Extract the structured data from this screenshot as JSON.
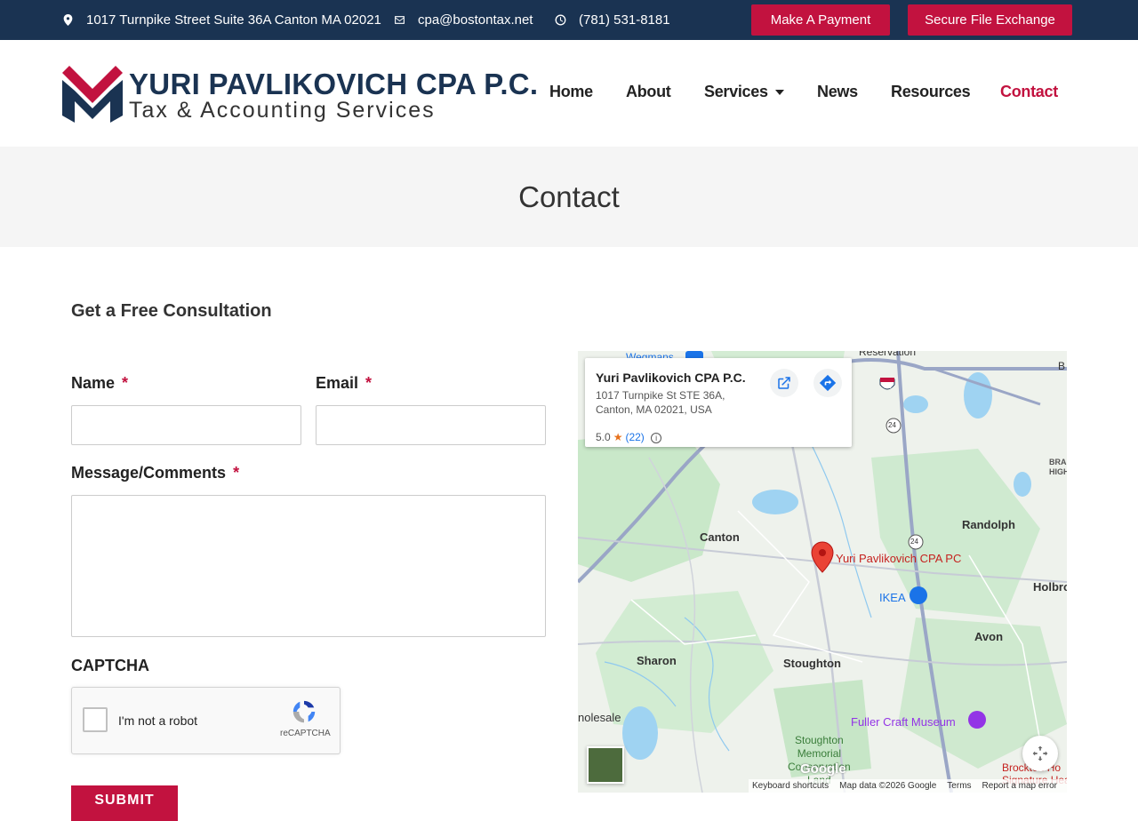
{
  "topbar": {
    "address": "1017 Turnpike Street Suite 36A Canton MA 02021",
    "email": "cpa@bostontax.net",
    "phone": "(781) 531-8181",
    "payment_button": "Make A Payment",
    "file_exchange_button": "Secure File Exchange"
  },
  "logo": {
    "title": "YURI PAVLIKOVICH CPA P.C.",
    "subtitle": "Tax & Accounting Services"
  },
  "nav": {
    "home": "Home",
    "about": "About",
    "services": "Services",
    "news": "News",
    "resources": "Resources",
    "contact": "Contact"
  },
  "page": {
    "title": "Contact"
  },
  "form": {
    "heading": "Get a Free Consultation",
    "name_label": "Name",
    "email_label": "Email",
    "message_label": "Message/Comments",
    "captcha_label": "CAPTCHA",
    "required_mark": "*",
    "captcha_text": "I'm not a robot",
    "captcha_brand": "reCAPTCHA",
    "submit": "SUBMIT"
  },
  "map": {
    "card_title": "Yuri Pavlikovich CPA P.C.",
    "card_address_line1": "1017 Turnpike St STE 36A,",
    "card_address_line2": "Canton, MA 02021, USA",
    "rating": "5.0",
    "review_count": "(22)",
    "places": {
      "wegmans": "Wegmans",
      "reservation": "Reservation",
      "canton": "Canton",
      "randolph": "Randolph",
      "holbrook": "Holbro",
      "ikea": "IKEA",
      "avon": "Avon",
      "sharon": "Sharon",
      "stoughton": "Stoughton",
      "fuller": "Fuller Craft Museum",
      "wholesale": "nolesale",
      "memorial": "Stoughton\nMemorial\nConservation\nLand",
      "brockton": "Brockton Ho\nSignature Hea",
      "braintree": "BRAIN\nHIGHL",
      "b": "B",
      "pin_label": "Yuri Pavlikovich CPA PC"
    },
    "routes": {
      "r93": "93",
      "r24a": "24",
      "r24b": "24"
    },
    "footer": {
      "shortcuts": "Keyboard shortcuts",
      "mapdata": "Map data ©2026 Google",
      "terms": "Terms",
      "report": "Report a map error"
    },
    "google": "Google"
  }
}
